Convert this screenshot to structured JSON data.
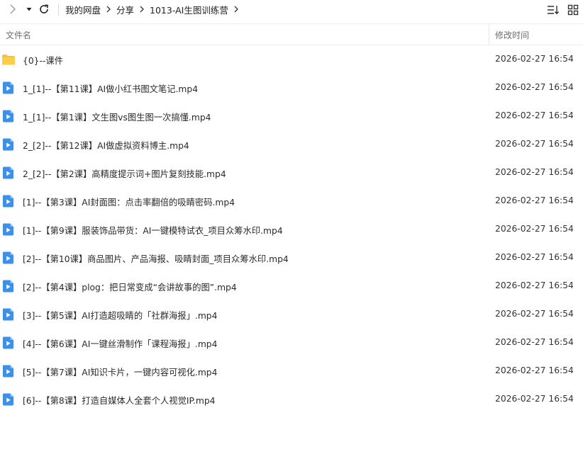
{
  "breadcrumb": [
    "我的网盘",
    "分享",
    "1013-AI生图训练营"
  ],
  "header": {
    "name_label": "文件名",
    "time_label": "修改时间"
  },
  "files": [
    {
      "name": "{0}--课件",
      "time": "2026-02-27 16:54",
      "type": "folder-icon"
    },
    {
      "name": "1_[1]--【第11课】AI做小红书图文笔记.mp4",
      "time": "2026-02-27 16:54",
      "type": "video-file-icon"
    },
    {
      "name": "1_[1]--【第1课】文生图vs图生图一次搞懂.mp4",
      "time": "2026-02-27 16:54",
      "type": "video-file-icon"
    },
    {
      "name": "2_[2]--【第12课】AI做虚拟资料博主.mp4",
      "time": "2026-02-27 16:54",
      "type": "video-file-icon"
    },
    {
      "name": "2_[2]--【第2课】高精度提示词+图片复刻技能.mp4",
      "time": "2026-02-27 16:54",
      "type": "video-file-icon"
    },
    {
      "name": "[1]--【第3课】AI封面图：点击率翻倍的吸睛密码.mp4",
      "time": "2026-02-27 16:54",
      "type": "video-file-icon"
    },
    {
      "name": "[1]--【第9课】服装饰品带货：AI一键模特试衣_项目众筹水印.mp4",
      "time": "2026-02-27 16:54",
      "type": "video-file-icon"
    },
    {
      "name": "[2]--【第10课】商品图片、产品海报、吸睛封面_项目众筹水印.mp4",
      "time": "2026-02-27 16:54",
      "type": "video-file-icon"
    },
    {
      "name": "[2]--【第4课】plog：把日常变成“会讲故事的图”.mp4",
      "time": "2026-02-27 16:54",
      "type": "video-file-icon"
    },
    {
      "name": "[3]--【第5课】AI打造超吸睛的「社群海报」.mp4",
      "time": "2026-02-27 16:54",
      "type": "video-file-icon"
    },
    {
      "name": "[4]--【第6课】AI一键丝滑制作「课程海报」.mp4",
      "time": "2026-02-27 16:54",
      "type": "video-file-icon"
    },
    {
      "name": "[5]--【第7课】AI知识卡片，一键内容可视化.mp4",
      "time": "2026-02-27 16:54",
      "type": "video-file-icon"
    },
    {
      "name": "[6]--【第8课】打造自媒体人全套个人视觉IP.mp4",
      "time": "2026-02-27 16:54",
      "type": "video-file-icon"
    }
  ],
  "colors": {
    "folder": "#f9c236",
    "video": "#3d8fe8",
    "header_text": "#6e6e6e",
    "divider": "#ededed"
  }
}
